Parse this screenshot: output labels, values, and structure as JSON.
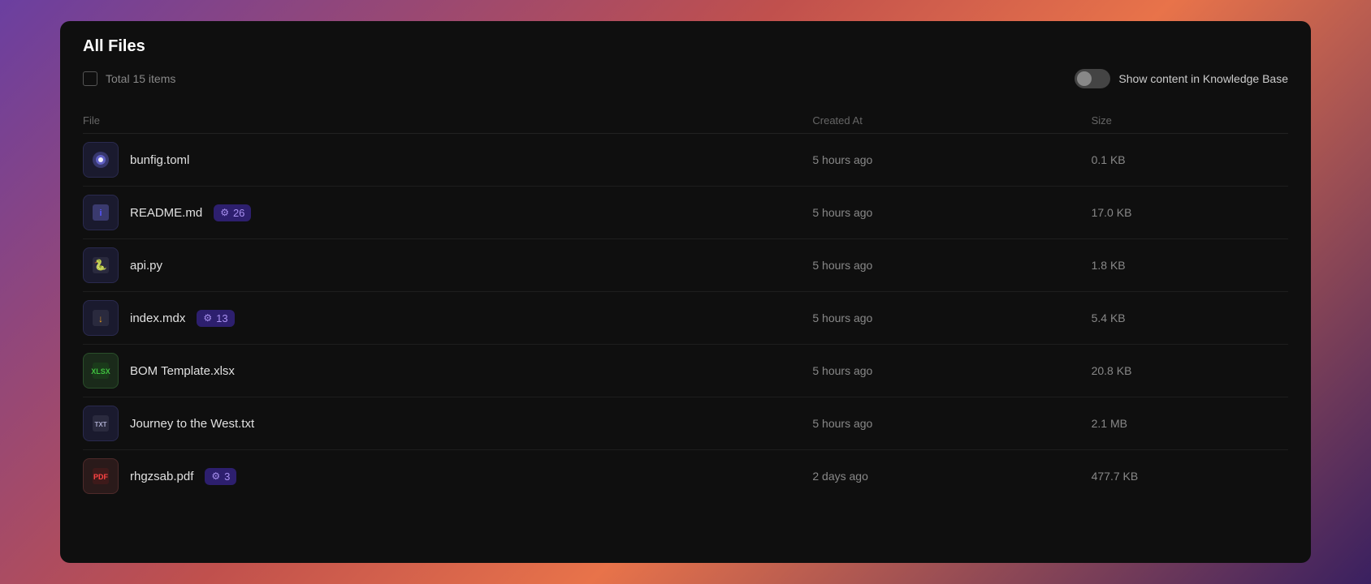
{
  "window": {
    "title": "All Files",
    "total_label": "Total 15 items",
    "toggle_label": "Show content in Knowledge Base"
  },
  "table": {
    "columns": [
      {
        "key": "file",
        "label": "File"
      },
      {
        "key": "created_at",
        "label": "Created At"
      },
      {
        "key": "size",
        "label": "Size"
      }
    ],
    "rows": [
      {
        "name": "bunfig.toml",
        "icon_type": "toml",
        "badge": null,
        "created_at": "5 hours ago",
        "size": "0.1 KB"
      },
      {
        "name": "README.md",
        "icon_type": "md",
        "badge": {
          "icon": "⚙",
          "count": "26"
        },
        "created_at": "5 hours ago",
        "size": "17.0 KB"
      },
      {
        "name": "api.py",
        "icon_type": "py",
        "badge": null,
        "created_at": "5 hours ago",
        "size": "1.8 KB"
      },
      {
        "name": "index.mdx",
        "icon_type": "mdx",
        "badge": {
          "icon": "⚙",
          "count": "13"
        },
        "created_at": "5 hours ago",
        "size": "5.4 KB"
      },
      {
        "name": "BOM Template.xlsx",
        "icon_type": "xlsx",
        "badge": null,
        "created_at": "5 hours ago",
        "size": "20.8 KB"
      },
      {
        "name": "Journey to the West.txt",
        "icon_type": "txt",
        "badge": null,
        "created_at": "5 hours ago",
        "size": "2.1 MB"
      },
      {
        "name": "rhgzsab.pdf",
        "icon_type": "pdf",
        "badge": {
          "icon": "⚙",
          "count": "3"
        },
        "created_at": "2 days ago",
        "size": "477.7 KB"
      }
    ]
  }
}
